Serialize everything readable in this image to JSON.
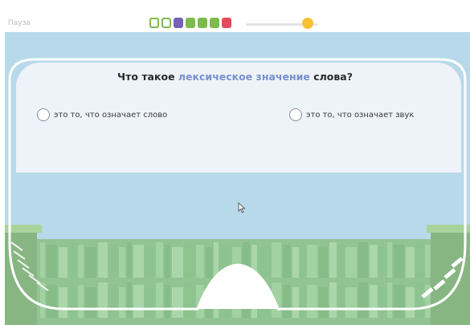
{
  "top_bar": {
    "pause_label": "Пауза",
    "progress_colors": [
      "#7dbb4b",
      "#7dbb4b",
      "#7661b6",
      "#7dbb4b",
      "#7dbb4b",
      "#7dbb4b",
      "#e44a5d"
    ],
    "progress_outlined": [
      true,
      true,
      false,
      false,
      false,
      false,
      false
    ],
    "marker_color": "#f6c232"
  },
  "question": {
    "before": "Что такое ",
    "highlight": "лексическое значение",
    "after": " слова?",
    "highlight_color": "#7a8fd0"
  },
  "options": [
    {
      "label": "это то, что означает слово"
    },
    {
      "label": "это то, что означает звук"
    }
  ],
  "colors": {
    "sky": "#b8d9ea",
    "shelf_green": "#8cc084",
    "panel": "#eef3f9"
  },
  "icons": {
    "cursor": "mouse-pointer-icon",
    "pause": "pause-label"
  }
}
